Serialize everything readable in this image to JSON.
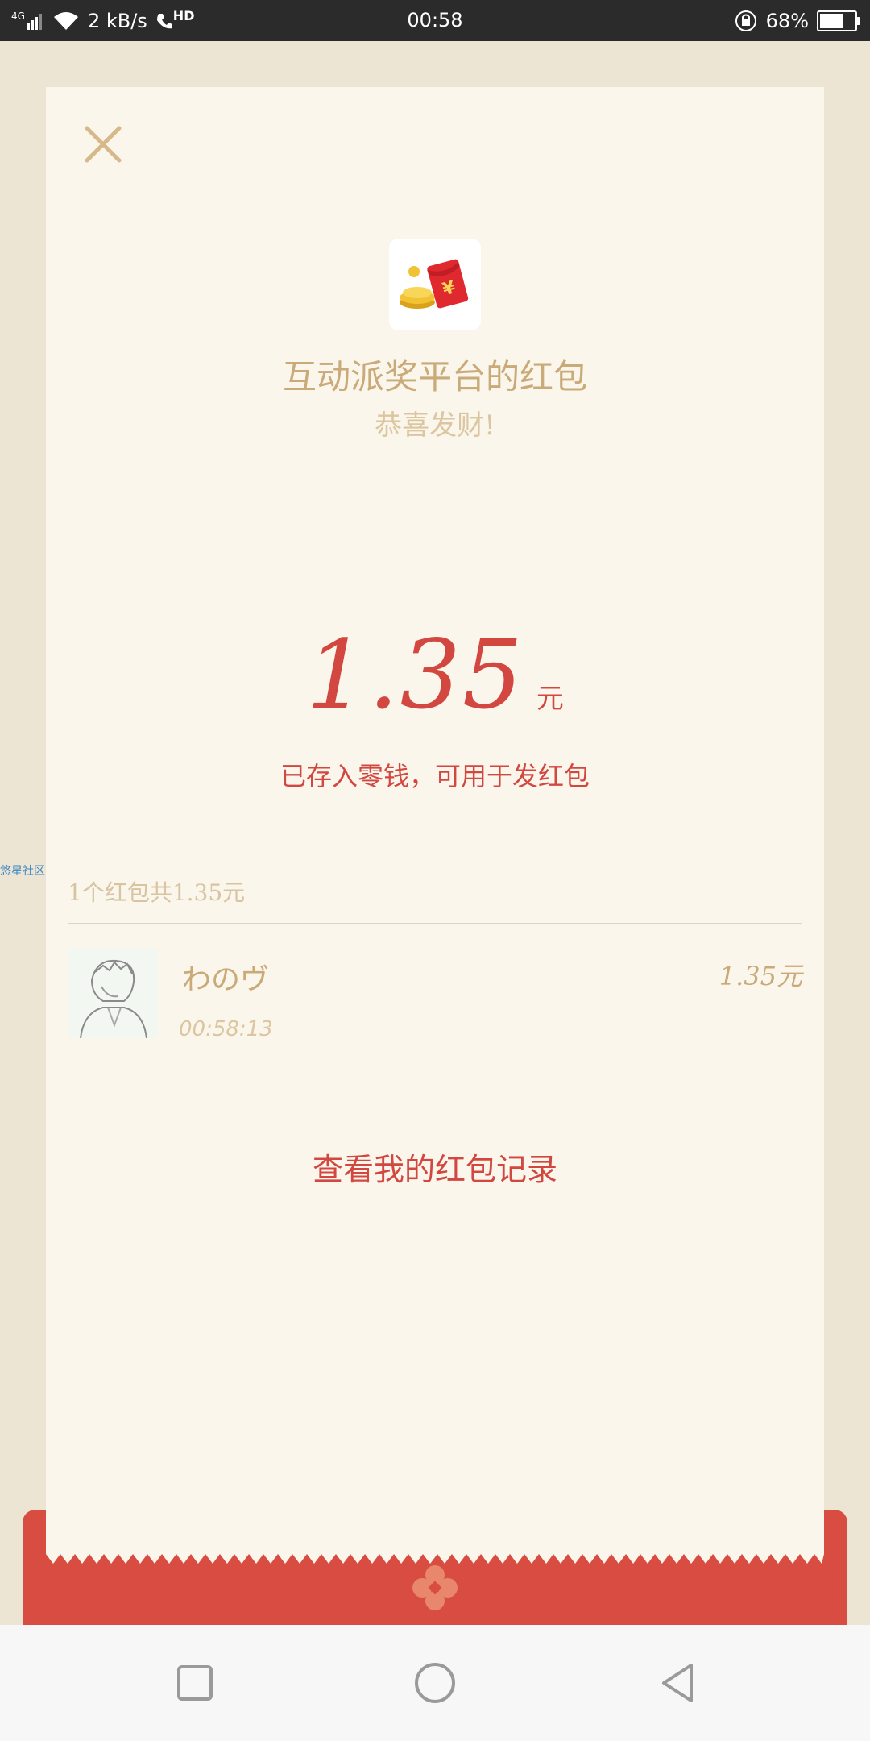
{
  "status_bar": {
    "network": "4G",
    "speed": "2 kB/s",
    "call": "HD",
    "time": "00:58",
    "battery": "68%",
    "battery_level": 0.68
  },
  "side_label": "悠星社区",
  "card": {
    "title": "互动派奖平台的红包",
    "subtitle": "恭喜发财!",
    "amount": "1.35",
    "amount_unit": "元",
    "saved_note": "已存入零钱，可用于发红包",
    "summary": "1个红包共1.35元",
    "records": [
      {
        "name": "わのヴ",
        "time": "00:58:13",
        "amount": "1.35元"
      }
    ],
    "view_records_label": "查看我的红包记录"
  },
  "icons": {
    "close": "close-icon",
    "app": "red-envelope-coins-icon",
    "seal": "flower-seal-icon",
    "nav_recent": "square-icon",
    "nav_home": "circle-icon",
    "nav_back": "triangle-back-icon"
  },
  "colors": {
    "accent_red": "#d2473f",
    "gold_text": "#c9aa78",
    "card_bg": "#faf6ec",
    "envelope_red": "#d84c41"
  }
}
